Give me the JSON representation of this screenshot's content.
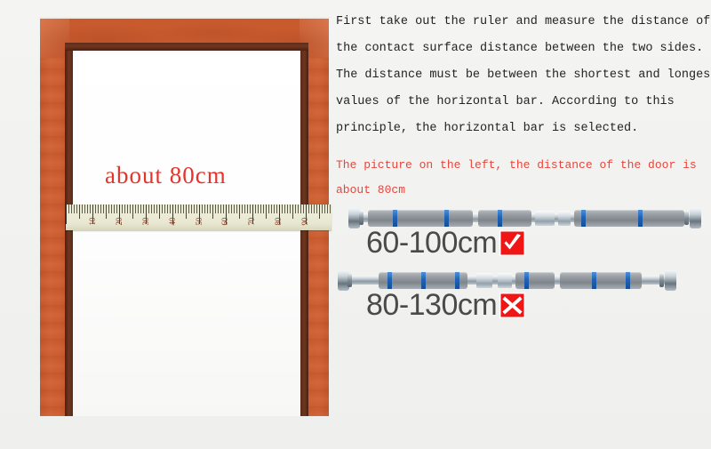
{
  "background_color": "#f2f2f0",
  "door_figure": {
    "frame_color": "#c85a2e",
    "reveal_color": "#5d2c18",
    "opening_color": "#ffffff",
    "measurement_label": "about  80cm",
    "measurement_label_color": "#e8332a",
    "ruler": {
      "numbers": [
        "10",
        "20",
        "30",
        "40",
        "50",
        "60",
        "70",
        "80",
        "90"
      ],
      "body_color": "#eeedd8",
      "tick_color": "#4a4a3a",
      "number_color": "#8a3a20"
    }
  },
  "right_panel": {
    "instruction": {
      "color": "#232323",
      "lines": [
        "First take out the ruler and measure the distance of",
        "the contact surface distance between the two sides.",
        "The distance must be between the shortest and longest",
        "values of the horizontal bar. According to this",
        "principle, the horizontal bar is selected."
      ]
    },
    "note": {
      "color": "#e8453c",
      "lines": [
        "The picture on the left, the distance of the door is",
        "about 80cm"
      ]
    },
    "products": [
      {
        "size_label": "60-100cm",
        "mark": "check-mark",
        "mark_color": "#f01616",
        "size_text_color": "#4a4a4a"
      },
      {
        "size_label": "80-130cm",
        "mark": "cross-mark",
        "mark_color": "#f01616",
        "size_text_color": "#4a4a4a"
      }
    ]
  }
}
